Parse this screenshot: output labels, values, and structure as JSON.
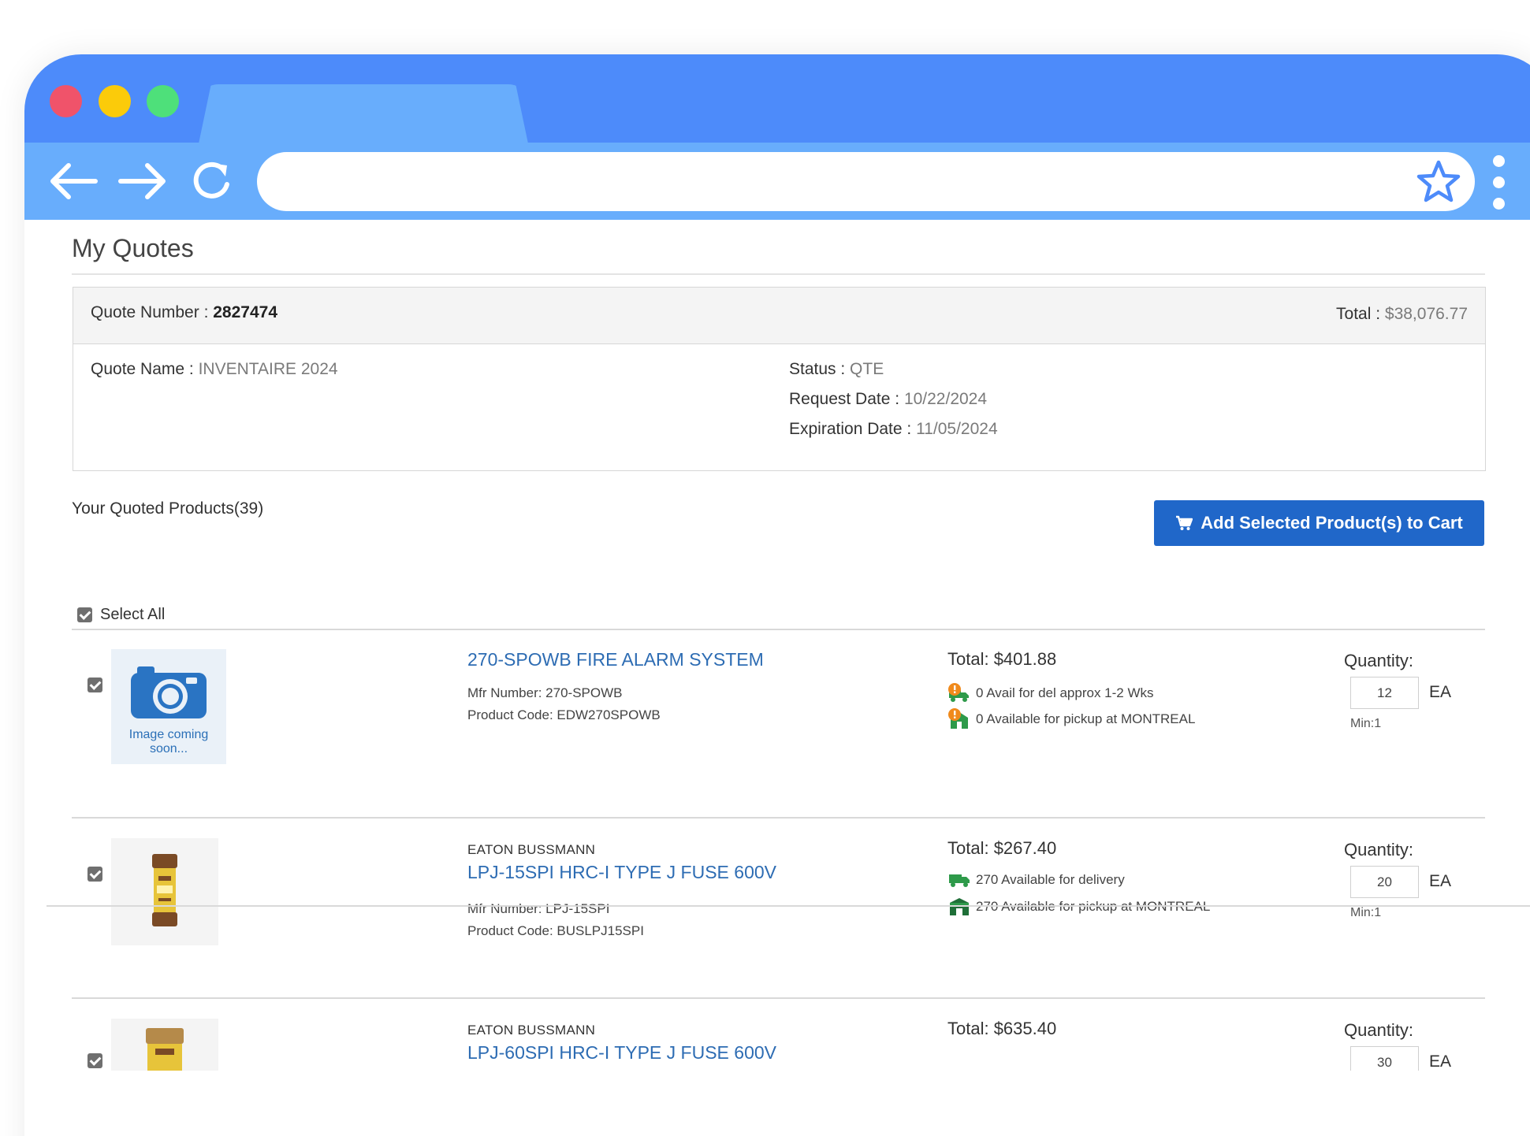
{
  "page": {
    "title": "My Quotes",
    "quote": {
      "number_label": "Quote Number :",
      "number": "2827474",
      "total_label": "Total :",
      "total": "$38,076.77",
      "name_label": "Quote Name :",
      "name": "INVENTAIRE 2024",
      "status_label": "Status :",
      "status": "QTE",
      "request_label": "Request Date :",
      "request_date": "10/22/2024",
      "expiration_label": "Expiration Date :",
      "expiration_date": "11/05/2024"
    },
    "products_title": "Your Quoted Products(39)",
    "add_cart_label": "Add Selected Product(s) to Cart",
    "select_all_label": "Select All",
    "products": [
      {
        "brand": "",
        "name": "270-SPOWB FIRE ALARM SYSTEM",
        "mfr": "Mfr Number: 270-SPOWB",
        "code": "Product Code: EDW270SPOWB",
        "total": "Total:  $401.88",
        "delivery": "0 Avail for del approx 1-2 Wks",
        "pickup": "0 Available for pickup at MONTREAL",
        "quantity_label": "Quantity:",
        "quantity": "12",
        "uom": "EA",
        "min": "Min:1",
        "image_text": "Image coming soon..."
      },
      {
        "brand": "EATON BUSSMANN",
        "name": "LPJ-15SPI HRC-I TYPE J FUSE 600V",
        "mfr": "Mfr Number: LPJ-15SPI",
        "code": "Product Code: BUSLPJ15SPI",
        "total": "Total:  $267.40",
        "delivery": "270 Available for delivery",
        "pickup": "270 Available for pickup at MONTREAL",
        "quantity_label": "Quantity:",
        "quantity": "20",
        "uom": "EA",
        "min": "Min:1"
      },
      {
        "brand": "EATON BUSSMANN",
        "name": "LPJ-60SPI HRC-I TYPE J FUSE 600V",
        "total": "Total:  $635.40",
        "quantity_label": "Quantity:",
        "quantity": "30",
        "uom": "EA"
      }
    ]
  },
  "colors": {
    "titlebar": "#4d8bfa",
    "toolbar": "#68adfc",
    "link": "#2d6cb3",
    "button": "#2067c9",
    "available_green": "#2e9a4a",
    "unavailable_orange": "#f08a1c"
  }
}
